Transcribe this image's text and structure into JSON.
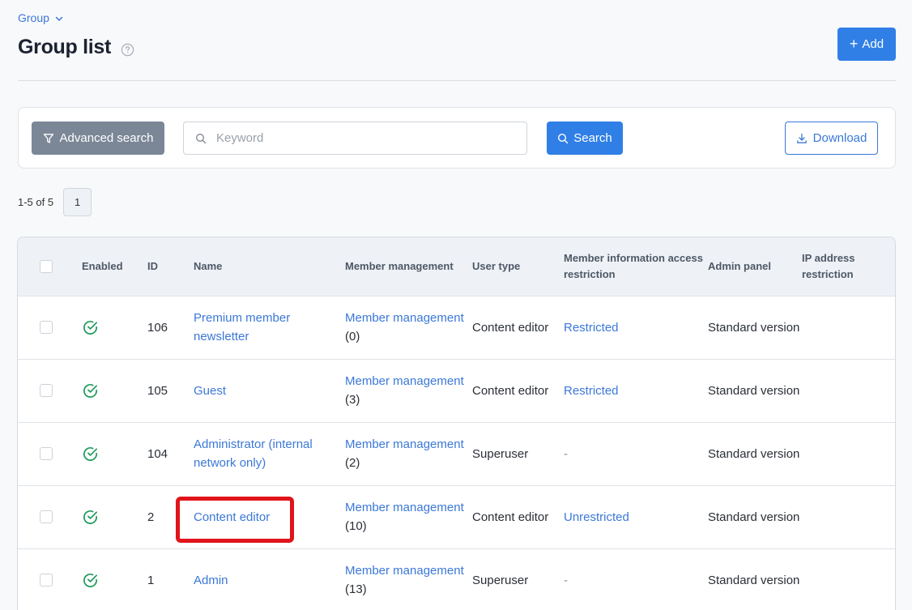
{
  "breadcrumb": {
    "label": "Group"
  },
  "page": {
    "title": "Group list",
    "add_label": "Add"
  },
  "search": {
    "advanced_label": "Advanced search",
    "placeholder": "Keyword",
    "value": "",
    "search_label": "Search",
    "download_label": "Download"
  },
  "pager": {
    "count_text": "1-5 of 5",
    "current_page": "1"
  },
  "table": {
    "headers": {
      "enabled": "Enabled",
      "id": "ID",
      "name": "Name",
      "member_management": "Member management",
      "user_type": "User type",
      "member_info_restriction": "Member information access restriction",
      "admin_panel": "Admin panel",
      "ip_restriction": "IP address restriction"
    },
    "rows": [
      {
        "id": "106",
        "name": "Premium member newsletter",
        "member_link": "Member management",
        "member_count": "(0)",
        "user_type": "Content editor",
        "restriction": "Restricted",
        "admin_panel": "Standard version",
        "ip_restriction": ""
      },
      {
        "id": "105",
        "name": "Guest",
        "member_link": "Member management",
        "member_count": "(3)",
        "user_type": "Content editor",
        "restriction": "Restricted",
        "admin_panel": "Standard version",
        "ip_restriction": ""
      },
      {
        "id": "104",
        "name": "Administrator (internal network only)",
        "member_link": "Member management",
        "member_count": "(2)",
        "user_type": "Superuser",
        "restriction": "-",
        "admin_panel": "Standard version",
        "ip_restriction": ""
      },
      {
        "id": "2",
        "name": "Content editor",
        "member_link": "Member management",
        "member_count": "(10)",
        "user_type": "Content editor",
        "restriction": "Unrestricted",
        "admin_panel": "Standard version",
        "ip_restriction": ""
      },
      {
        "id": "1",
        "name": "Admin",
        "member_link": "Member management",
        "member_count": "(13)",
        "user_type": "Superuser",
        "restriction": "-",
        "admin_panel": "Standard version",
        "ip_restriction": ""
      }
    ]
  },
  "colors": {
    "accent": "#2f7fe6",
    "link": "#3b78d8",
    "enabled_check": "#1e9a5a",
    "highlight": "#e0141a"
  },
  "icons": {
    "breadcrumb": "chevron-down-icon",
    "help": "help-circle-icon",
    "add": "plus-icon",
    "advanced": "filter-icon",
    "search": "search-icon",
    "download": "download-icon",
    "enabled": "check-circle-icon"
  }
}
